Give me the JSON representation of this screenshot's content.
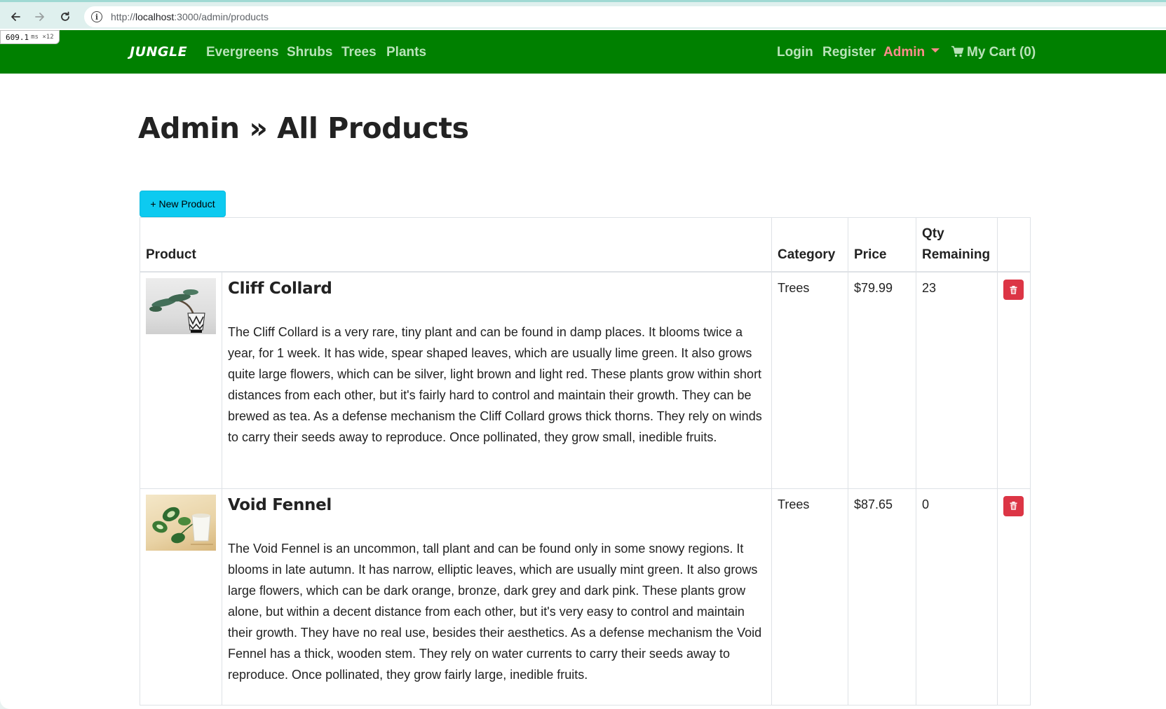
{
  "browser": {
    "url_scheme": "http://",
    "url_host": "localhost",
    "url_path": ":3000/admin/products",
    "back_icon": "arrow-left-icon",
    "forward_icon": "arrow-right-icon",
    "reload_icon": "reload-icon",
    "info_icon": "info-icon"
  },
  "perf": {
    "value": "609.1",
    "unit": "ms ×12"
  },
  "navbar": {
    "brand": "JUNGLE",
    "links": [
      "Evergreens",
      "Shrubs",
      "Trees",
      "Plants"
    ],
    "login": "Login",
    "register": "Register",
    "admin": "Admin",
    "cart": "My Cart (0)",
    "colors": {
      "background": "#008000",
      "link": "#b9e3b9",
      "admin": "#ff8c8c"
    }
  },
  "page": {
    "title": "Admin » All Products",
    "new_product_label": "+ New Product"
  },
  "table": {
    "headers": {
      "product": "Product",
      "category": "Category",
      "price": "Price",
      "qty": "Qty Remaining"
    },
    "rows": [
      {
        "name": "Cliff Collard",
        "image": "bonsai-in-patterned-pot",
        "description": "The Cliff Collard is a very rare, tiny plant and can be found in damp places. It blooms twice a year, for 1 week. It has wide, spear shaped leaves, which are usually lime green. It also grows quite large flowers, which can be silver, light brown and light red. These plants grow within short distances from each other, but it's fairly hard to control and maintain their growth. They can be brewed as tea. As a defense mechanism the Cliff Collard grows thick thorns. They rely on winds to carry their seeds away to reproduce. Once pollinated, they grow small, inedible fruits.",
        "category": "Trees",
        "price": "$79.99",
        "qty": "23"
      },
      {
        "name": "Void Fennel",
        "image": "pothos-in-white-pot",
        "description": "The Void Fennel is an uncommon, tall plant and can be found only in some snowy regions. It blooms in late autumn. It has narrow, elliptic leaves, which are usually mint green. It also grows large flowers, which can be dark orange, bronze, dark grey and dark pink. These plants grow alone, but within a decent distance from each other, but it's very easy to control and maintain their growth. They have no real use, besides their aesthetics. As a defense mechanism the Void Fennel has a thick, wooden stem. They rely on water currents to carry their seeds away to reproduce. Once pollinated, they grow fairly large, inedible fruits.",
        "category": "Trees",
        "price": "$87.65",
        "qty": "0"
      }
    ],
    "delete_icon": "trash-icon",
    "colors": {
      "delete": "#dc3545",
      "new_button": "#0dcaf0"
    }
  }
}
